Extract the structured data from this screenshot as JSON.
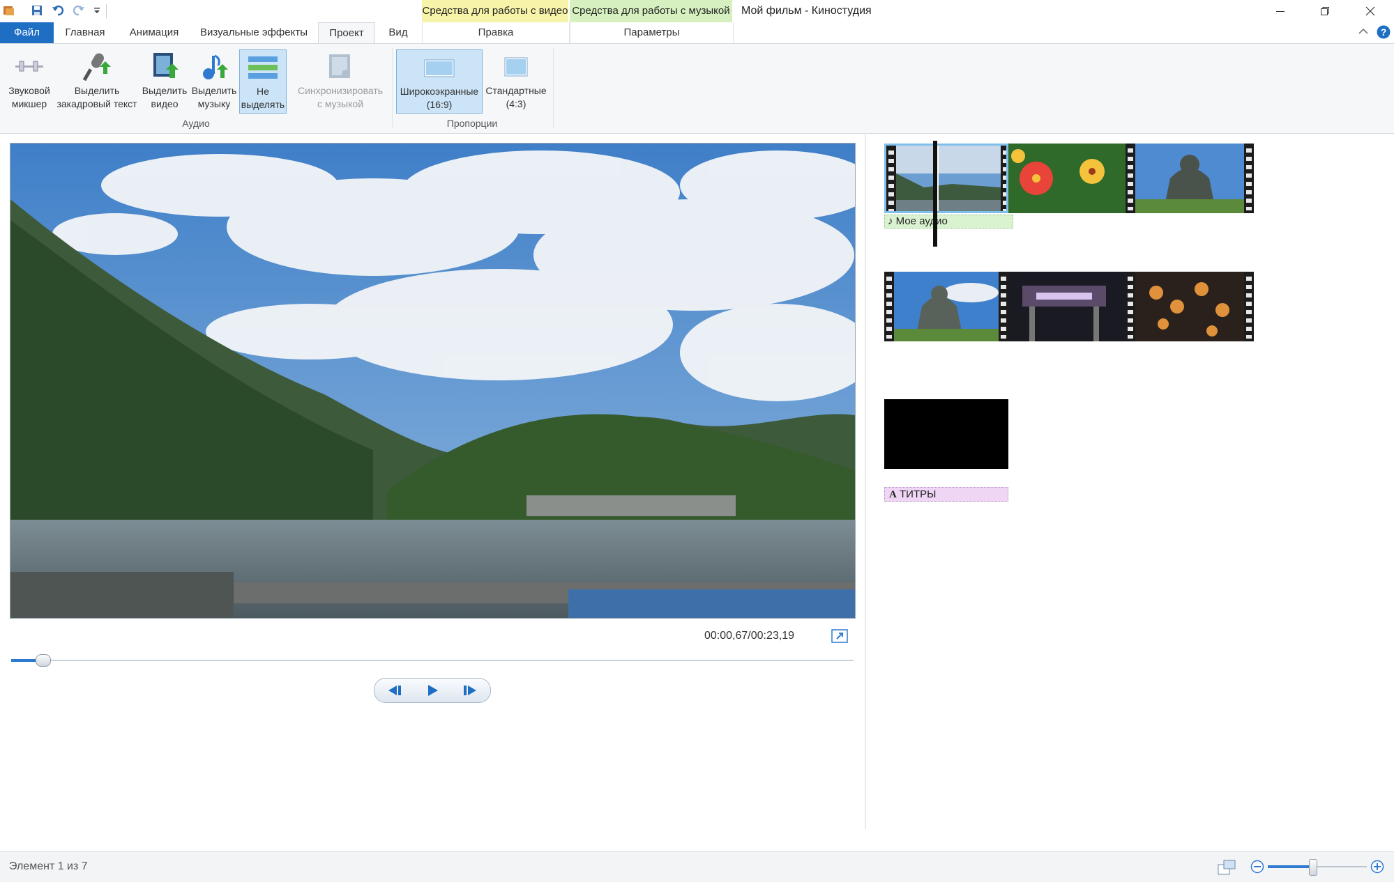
{
  "window": {
    "title": "Мой фильм - Киностудия",
    "context_tabs": [
      {
        "label": "Средства для работы с видео",
        "sub_tab": "Правка",
        "color": "#f7f3a8"
      },
      {
        "label": "Средства для работы с музыкой",
        "sub_tab": "Параметры",
        "color": "#d6f0c0"
      }
    ]
  },
  "tabs": [
    "Файл",
    "Главная",
    "Анимация",
    "Визуальные эффекты",
    "Проект",
    "Вид"
  ],
  "active_tab": "Проект",
  "ribbon": {
    "audio_group": {
      "label": "Аудио",
      "buttons": [
        {
          "line1": "Звуковой",
          "line2": "микшер",
          "icon": "mixer-icon"
        },
        {
          "line1": "Выделить",
          "line2": "закадровый текст",
          "icon": "microphone-icon"
        },
        {
          "line1": "Выделить",
          "line2": "видео",
          "icon": "video-film-icon"
        },
        {
          "line1": "Выделить",
          "line2": "музыку",
          "icon": "music-note-icon"
        },
        {
          "line1": "Не",
          "line2": "выделять",
          "icon": "equal-bars-icon",
          "selected": true
        },
        {
          "line1": "Синхронизировать",
          "line2": "с музыкой",
          "icon": "sync-music-icon",
          "disabled": true
        }
      ]
    },
    "aspect_group": {
      "label": "Пропорции",
      "buttons": [
        {
          "line1": "Широкоэкранные",
          "line2": "(16:9)",
          "icon": "widescreen-icon",
          "selected": true
        },
        {
          "line1": "Стандартные",
          "line2": "(4:3)",
          "icon": "standard-screen-icon"
        }
      ]
    }
  },
  "player": {
    "time": "00:00,67/00:23,19",
    "progress": 0.029
  },
  "storyboard": {
    "audio_label": "Мое аудио",
    "caption_label": "ТИТРЫ"
  },
  "status": {
    "item_text": "Элемент 1 из 7",
    "zoom": 0.45
  },
  "colors": {
    "accent": "#1e6fc4",
    "audio_track": "#d9f2d0",
    "caption_track": "#f0d6f5"
  }
}
